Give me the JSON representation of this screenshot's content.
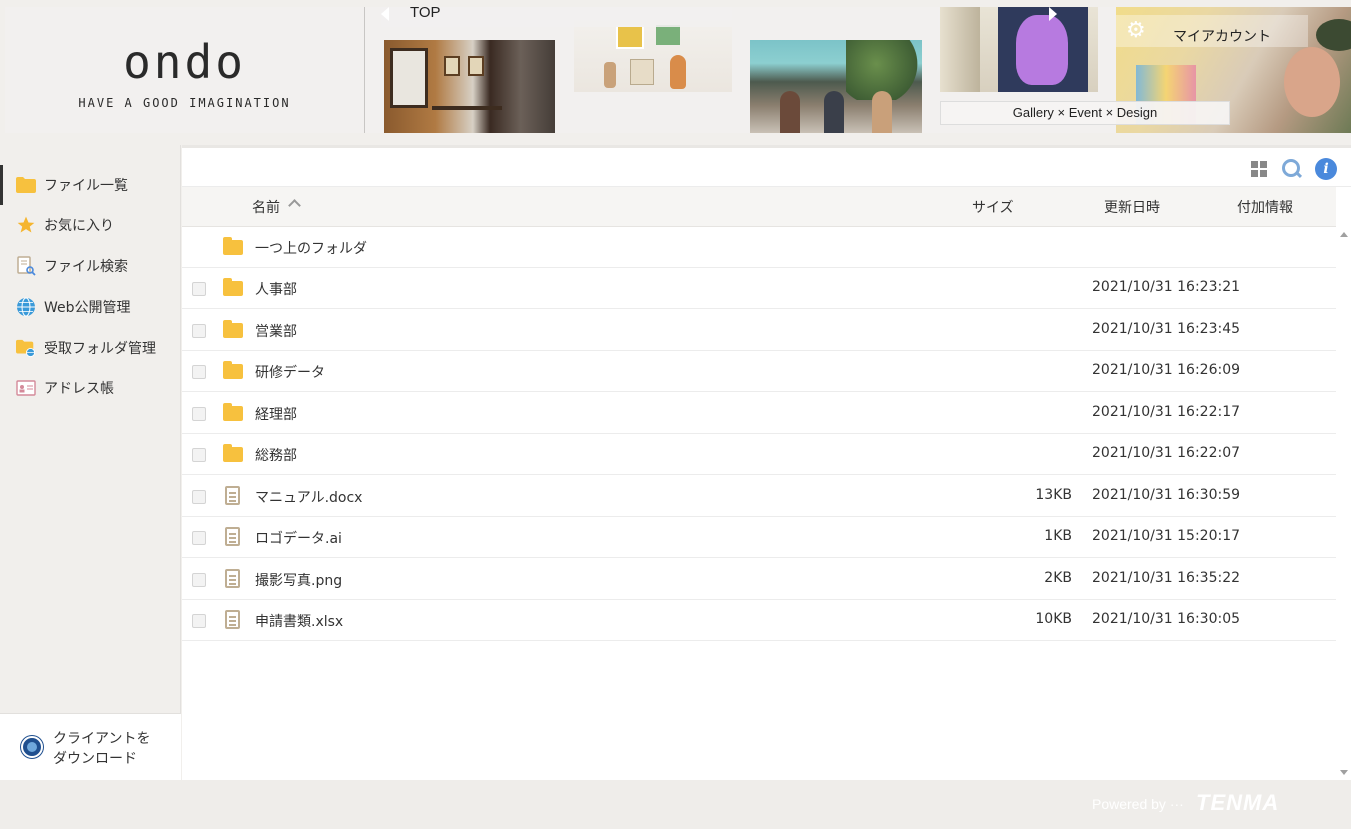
{
  "header": {
    "logo": "ondo",
    "tagline": "HAVE A GOOD IMAGINATION",
    "nav_top": "TOP",
    "event_label": "Gallery × Event × Design",
    "account_label": "マイアカウント"
  },
  "sidebar": {
    "items": [
      {
        "label": "ファイル一覧",
        "icon": "folder-icon",
        "active": true
      },
      {
        "label": "お気に入り",
        "icon": "star-icon",
        "active": false
      },
      {
        "label": "ファイル検索",
        "icon": "file-search-icon",
        "active": false
      },
      {
        "label": "Web公開管理",
        "icon": "globe-icon",
        "active": false
      },
      {
        "label": "受取フォルダ管理",
        "icon": "inbox-folder-icon",
        "active": false
      },
      {
        "label": "アドレス帳",
        "icon": "address-card-icon",
        "active": false
      }
    ],
    "download": {
      "line1": "クライアントを",
      "line2": "ダウンロード"
    }
  },
  "table": {
    "columns": {
      "name": "名前",
      "size": "サイズ",
      "updated": "更新日時",
      "extra": "付加情報"
    },
    "parent_folder": "一つ上のフォルダ",
    "rows": [
      {
        "name": "人事部",
        "type": "folder",
        "size": "",
        "updated": "2021/10/31 16:23:21"
      },
      {
        "name": "営業部",
        "type": "folder",
        "size": "",
        "updated": "2021/10/31 16:23:45"
      },
      {
        "name": "研修データ",
        "type": "folder",
        "size": "",
        "updated": "2021/10/31 16:26:09"
      },
      {
        "name": "経理部",
        "type": "folder",
        "size": "",
        "updated": "2021/10/31 16:22:17"
      },
      {
        "name": "総務部",
        "type": "folder",
        "size": "",
        "updated": "2021/10/31 16:22:07"
      },
      {
        "name": "マニュアル.docx",
        "type": "file",
        "size": "13KB",
        "updated": "2021/10/31 16:30:59"
      },
      {
        "name": "ロゴデータ.ai",
        "type": "file",
        "size": "1KB",
        "updated": "2021/10/31 15:20:17"
      },
      {
        "name": "撮影写真.png",
        "type": "file",
        "size": "2KB",
        "updated": "2021/10/31 16:35:22"
      },
      {
        "name": "申請書類.xlsx",
        "type": "file",
        "size": "10KB",
        "updated": "2021/10/31 16:30:05"
      }
    ]
  },
  "footer": {
    "powered_by": "Powered by ···",
    "brand": "TENMA"
  },
  "colors": {
    "folder": "#f7c13e",
    "accent_blue": "#4a89dc",
    "sidebar_bg": "#f1efec"
  }
}
